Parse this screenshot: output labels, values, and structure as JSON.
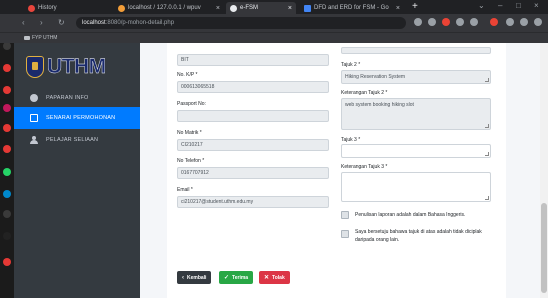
{
  "browser": {
    "tabs": [
      {
        "title": "History",
        "color": "#e8453c"
      },
      {
        "title": "localhost / 127.0.0.1 / wpuv",
        "color": "#f29d38"
      },
      {
        "title": "e-FSM",
        "color": "#e8eaed"
      },
      {
        "title": "DFD and ERD for FSM - Go",
        "color": "#4285f4"
      }
    ],
    "new_tab_label": "+",
    "url_host": "localhost",
    "url_path": ":8080/p-mohon-detail.php",
    "bookmark": "FYP UTHM",
    "ext_colors": [
      "#ea4335",
      "#9aa0a6",
      "#9aa0a6",
      "#9aa0a6"
    ]
  },
  "sidebar": {
    "logo_text": "UTHM",
    "items": [
      {
        "label": "PAPARAN INFO",
        "active": false
      },
      {
        "label": "SENARAI PERMOHONAN",
        "active": true
      },
      {
        "label": "PELAJAR SELIAAN",
        "active": false
      }
    ]
  },
  "form": {
    "top_value": "BIT",
    "noic_label": "No. K/P *",
    "noic_value": "000613065518",
    "passport_label": "Passport No:",
    "passport_value": "",
    "nomatrik_label": "No Matrik *",
    "nomatrik_value": "CI210217",
    "notel_label": "No Telefon *",
    "notel_value": "0167707912",
    "email_label": "Email *",
    "email_value": "ci210217@student.uthm.edu.my",
    "tajuk2_label": "Tajuk 2 *",
    "tajuk2_value": "Hiking Reservation System",
    "ket2_label": "Keterangan Tajuk 2 *",
    "ket2_value": "web system booking hiking slot",
    "tajuk3_label": "Tajuk 3 *",
    "tajuk3_value": "",
    "ket3_label": "Keterangan Tajuk 3 *",
    "ket3_value": "",
    "check1_label": "Penulisan laporan adalah dalam Bahasa Inggeris.",
    "check2_label": "Saya bersetuju bahawa tajuk di atas adalah tidak diciplak",
    "check2_label_line2": "daripada orang lain."
  },
  "buttons": {
    "back": "Kembali",
    "accept": "Terima",
    "reject": "Tolak"
  },
  "colors": {
    "sidebar_bg": "#343a40",
    "active_item": "#007bff",
    "accept": "#28a745",
    "reject": "#dc3545"
  }
}
